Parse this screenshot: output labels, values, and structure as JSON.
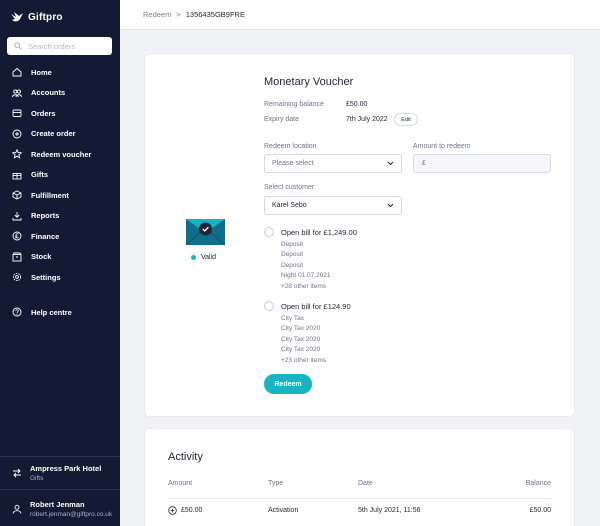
{
  "brand": {
    "name": "Giftpro",
    "accent": "#18b3c3",
    "sidebar_bg": "#141a33"
  },
  "search": {
    "placeholder": "Search orders"
  },
  "nav": [
    {
      "label": "Home",
      "icon": "home-icon"
    },
    {
      "label": "Accounts",
      "icon": "accounts-icon"
    },
    {
      "label": "Orders",
      "icon": "orders-icon"
    },
    {
      "label": "Create order",
      "icon": "plus-circle-icon"
    },
    {
      "label": "Redeem voucher",
      "icon": "star-icon"
    },
    {
      "label": "Gifts",
      "icon": "gift-icon"
    },
    {
      "label": "Fulfillment",
      "icon": "fulfillment-icon"
    },
    {
      "label": "Reports",
      "icon": "download-icon"
    },
    {
      "label": "Finance",
      "icon": "pound-icon"
    },
    {
      "label": "Stock",
      "icon": "box-icon"
    },
    {
      "label": "Settings",
      "icon": "gear-icon"
    }
  ],
  "help": {
    "label": "Help centre"
  },
  "account": {
    "hotel": "Ampress Park Hotel",
    "hotel_sub": "Gifts",
    "user_name": "Robert Jenman",
    "user_email": "robert.jenman@giftpro.co.uk"
  },
  "breadcrumb": {
    "parent": "Redeem",
    "separator": ">",
    "current": "1356435GB9FRE"
  },
  "voucher": {
    "title": "Monetary Voucher",
    "status": "Valid",
    "remaining_label": "Remaining balance",
    "remaining_value": "£50.00",
    "expiry_label": "Expiry date",
    "expiry_value": "7th July 2022",
    "edit_label": "Edit",
    "location_label": "Redeem location",
    "location_placeholder": "Please select",
    "amount_label": "Amount to redeem",
    "amount_prefix": "£",
    "customer_label": "Select customer",
    "customer_value": "Karel Sebo",
    "bills": [
      {
        "title": "Open bill for £1,249.00",
        "lines": [
          "Deposit",
          "Deposit",
          "Deposit",
          "Night 01.07.2021",
          "+28 other items"
        ]
      },
      {
        "title": "Open bill for £124.90",
        "lines": [
          "City Tax",
          "City Tax 2020",
          "City Tax 2020",
          "City Tax 2020",
          "+23 other items"
        ]
      }
    ],
    "redeem_label": "Redeem"
  },
  "activity": {
    "title": "Activity",
    "columns": [
      "Amount",
      "Type",
      "Date",
      "Balance"
    ],
    "rows": [
      {
        "amount": "£50.00",
        "type": "Activation",
        "date": "5th July 2021, 11:56",
        "balance": "£50.00"
      }
    ]
  }
}
